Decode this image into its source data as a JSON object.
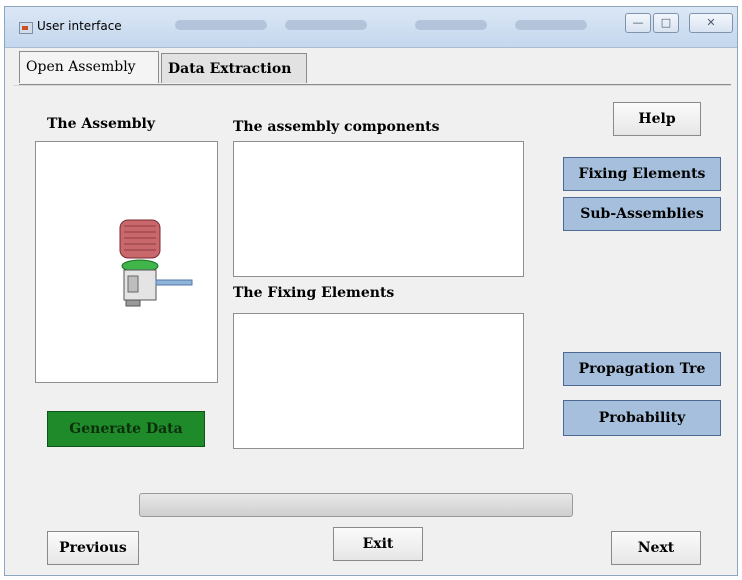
{
  "window": {
    "title": "User interface"
  },
  "tabs": [
    {
      "label": "Open Assembly",
      "active": true
    },
    {
      "label": "Data Extraction",
      "active": false
    }
  ],
  "panel": {
    "assembly_label": "The Assembly",
    "components_label": "The assembly components",
    "fixing_label": "The Fixing Elements"
  },
  "buttons": {
    "help": "Help",
    "fixing_elements": "Fixing Elements",
    "sub_assemblies": "Sub-Assemblies",
    "propagation_tree": "Propagation Tre",
    "probability": "Probability",
    "generate_data": "Generate Data",
    "previous": "Previous",
    "exit": "Exit",
    "next": "Next"
  },
  "progress": {
    "value": 0
  },
  "colors": {
    "blue_button": "#a6bfdc",
    "green_button": "#1f8a2a"
  }
}
